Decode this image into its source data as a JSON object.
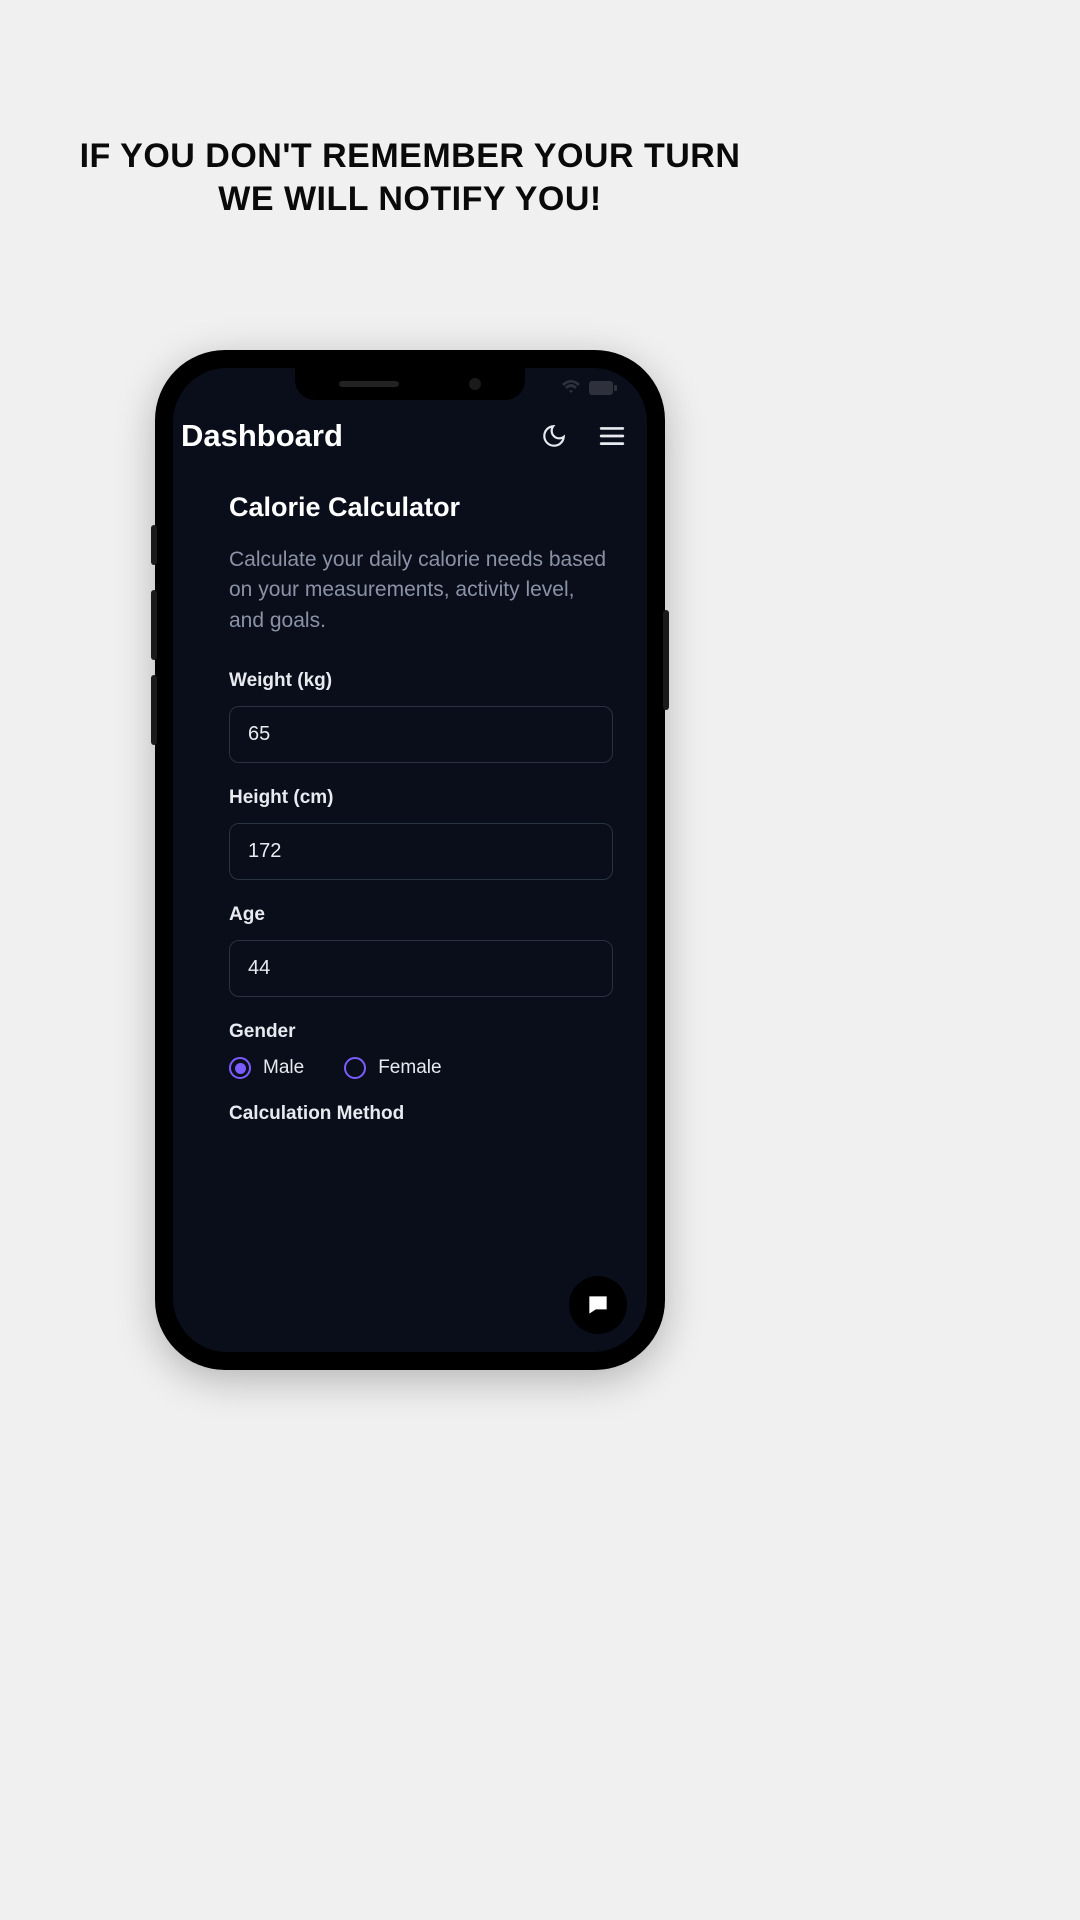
{
  "headline": "IF YOU DON'T REMEMBER YOUR TURN WE WILL NOTIFY YOU!",
  "app": {
    "header_title": "Dashboard",
    "section_title": "Calorie Calculator",
    "section_desc": "Calculate your daily calorie needs based on your measurements, activity level, and goals.",
    "fields": {
      "weight": {
        "label": "Weight (kg)",
        "value": "65"
      },
      "height": {
        "label": "Height (cm)",
        "value": "172"
      },
      "age": {
        "label": "Age",
        "value": "44"
      },
      "gender": {
        "label": "Gender",
        "options": {
          "male": "Male",
          "female": "Female"
        },
        "selected": "male"
      },
      "method": {
        "label": "Calculation Method"
      }
    }
  }
}
